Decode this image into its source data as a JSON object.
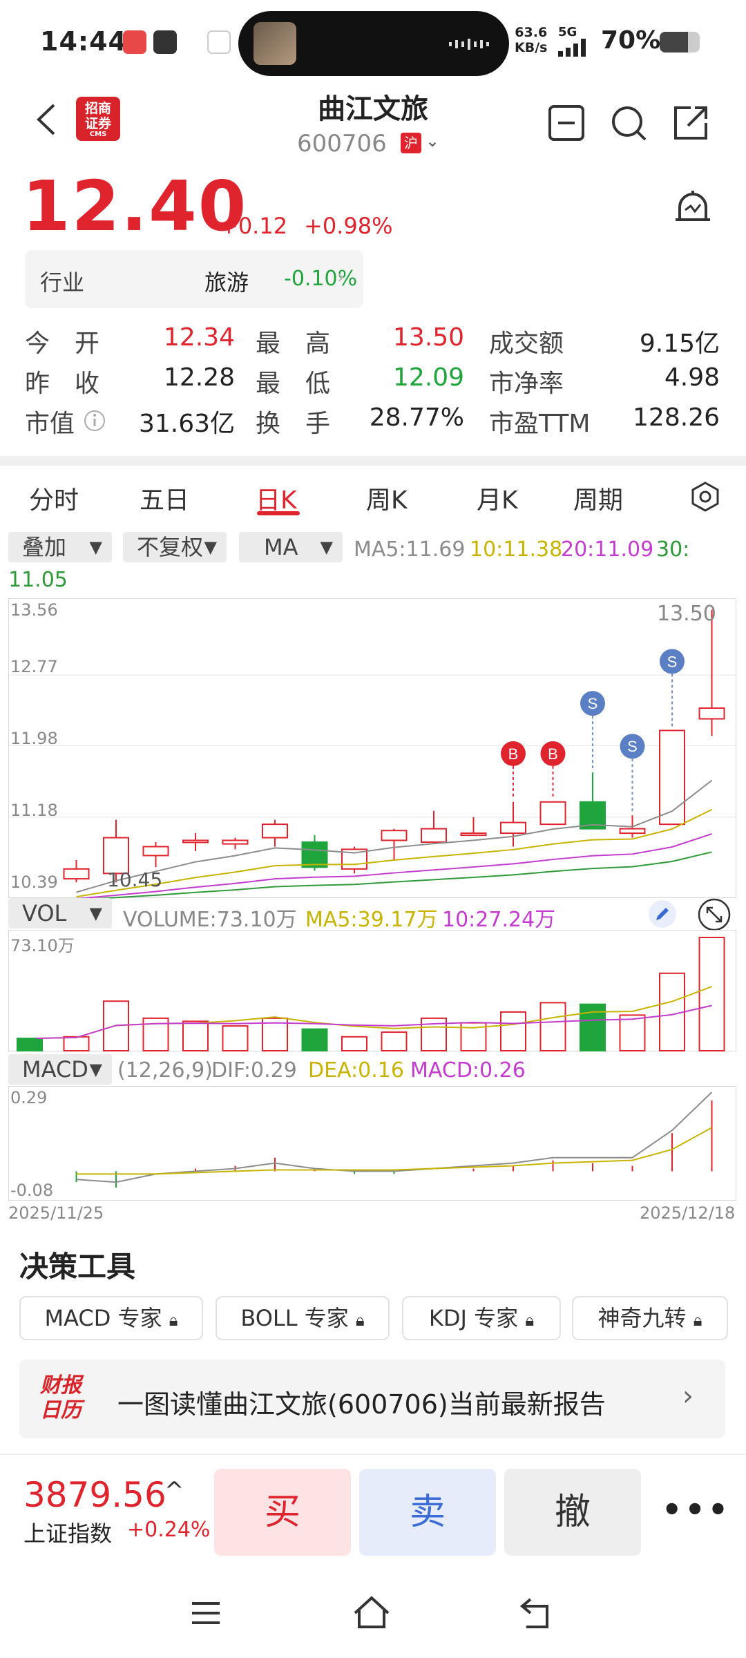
{
  "status_bar": {
    "time": "14:44",
    "net_speed_value": "63.6",
    "net_speed_unit": "KB/s",
    "signal": "5G",
    "battery": "70%",
    "battery_level": 0.7
  },
  "header": {
    "logo_text": "招商证券",
    "logo_sub": "CMS",
    "stock_name": "曲江文旅",
    "stock_code": "600706",
    "market_badge": "沪"
  },
  "quote": {
    "price": "12.40",
    "change": "+0.12",
    "change_pct": "+0.98%",
    "industry_label": "行业",
    "industry_name": "旅游",
    "industry_pct": "-0.10%",
    "rows": [
      {
        "l1": "今　开",
        "v1": "12.34",
        "l2": "最　高",
        "v2": "13.50",
        "l3": "成交额",
        "v3": "9.15亿"
      },
      {
        "l1": "昨　收",
        "v1": "12.28",
        "l2": "最　低",
        "v2": "12.09",
        "l3": "市净率",
        "v3": "4.98"
      },
      {
        "l1": "市值",
        "v1": "31.63亿",
        "l2": "换　手",
        "v2": "28.77%",
        "l3": "市盈TTM",
        "v3": "128.26"
      }
    ]
  },
  "tabs": [
    "分时",
    "五日",
    "日K",
    "周K",
    "月K",
    "周期"
  ],
  "active_tab": "日K",
  "controls": {
    "overlay": "叠加",
    "adjust": "不复权",
    "indicator": "MA",
    "ma5": "MA5:11.69",
    "ma10": "10:11.38",
    "ma20": "20:11.09",
    "ma30": "30:",
    "ma30_val": "11.05"
  },
  "kline": {
    "y_top": "13.56",
    "y_2": "12.77",
    "y_3": "11.98",
    "y_4": "11.18",
    "y_bottom": "10.39",
    "low_label": "10.45",
    "high_label": "13.50"
  },
  "volume": {
    "selector": "VOL",
    "label": "VOLUME:73.10万",
    "ma5": "MA5:39.17万",
    "ma10": "10:27.24万",
    "y_top": "73.10万"
  },
  "macd": {
    "selector": "MACD",
    "params": "(12,26,9)",
    "dif": "DIF:0.29",
    "dea": "DEA:0.16",
    "macd": "MACD:0.26",
    "y_top": "0.29",
    "y_bottom": "-0.08",
    "date_start": "2025/11/25",
    "date_end": "2025/12/18"
  },
  "tools": {
    "title": "决策工具",
    "buttons": [
      "MACD 专家",
      "BOLL 专家",
      "KDJ 专家",
      "神奇九转"
    ],
    "report_icon": "财报日历",
    "report_text": "一图读懂曲江文旅(600706)当前最新报告"
  },
  "bottom": {
    "index_value": "3879.56",
    "index_name": "上证指数",
    "index_pct": "+0.24%",
    "buy": "买",
    "sell": "卖",
    "cancel": "撤",
    "more": "•••"
  },
  "colors": {
    "up": "#e0242e",
    "down": "#1fa53b",
    "ma5": "#8c8c8c",
    "ma10": "#c8b400",
    "ma20": "#c43ccf",
    "ma30": "#2f9a3a"
  },
  "chart_data": {
    "type": "candlestick",
    "dates": [
      "2025/11/25",
      "2025/12/18"
    ],
    "candles": [
      {
        "o": 10.49,
        "c": 10.6,
        "h": 10.7,
        "l": 10.45
      },
      {
        "o": 10.55,
        "c": 10.95,
        "h": 11.15,
        "l": 10.45
      },
      {
        "o": 10.75,
        "c": 10.85,
        "h": 10.9,
        "l": 10.62
      },
      {
        "o": 10.9,
        "c": 10.92,
        "h": 11.0,
        "l": 10.8
      },
      {
        "o": 10.88,
        "c": 10.92,
        "h": 10.95,
        "l": 10.82
      },
      {
        "o": 10.95,
        "c": 11.1,
        "h": 11.15,
        "l": 10.85
      },
      {
        "o": 10.9,
        "c": 10.62,
        "h": 10.98,
        "l": 10.58
      },
      {
        "o": 10.6,
        "c": 10.82,
        "h": 10.85,
        "l": 10.55
      },
      {
        "o": 10.92,
        "c": 11.03,
        "h": 11.05,
        "l": 10.7
      },
      {
        "o": 10.9,
        "c": 11.05,
        "h": 11.25,
        "l": 10.88
      },
      {
        "o": 11.0,
        "c": 11.0,
        "h": 11.18,
        "l": 10.98
      },
      {
        "o": 11.0,
        "c": 11.12,
        "h": 11.35,
        "l": 10.85
      },
      {
        "o": 11.1,
        "c": 11.35,
        "h": 11.35,
        "l": 11.1
      },
      {
        "o": 11.35,
        "c": 11.05,
        "h": 11.68,
        "l": 11.05
      },
      {
        "o": 11.0,
        "c": 11.05,
        "h": 11.2,
        "l": 10.95
      },
      {
        "o": 11.1,
        "c": 12.15,
        "h": 12.15,
        "l": 11.1
      },
      {
        "o": 12.28,
        "c": 12.4,
        "h": 13.5,
        "l": 12.09
      }
    ],
    "volume": [
      8,
      9,
      32,
      21,
      19,
      16,
      21,
      14,
      9,
      12,
      21,
      18,
      25,
      31,
      30,
      23,
      50,
      73.1
    ],
    "signals": [
      {
        "i": 12,
        "t": "B"
      },
      {
        "i": 13,
        "t": "B"
      },
      {
        "i": 14,
        "t": "S"
      },
      {
        "i": 15,
        "t": "S"
      },
      {
        "i": 16,
        "t": "S"
      }
    ]
  }
}
